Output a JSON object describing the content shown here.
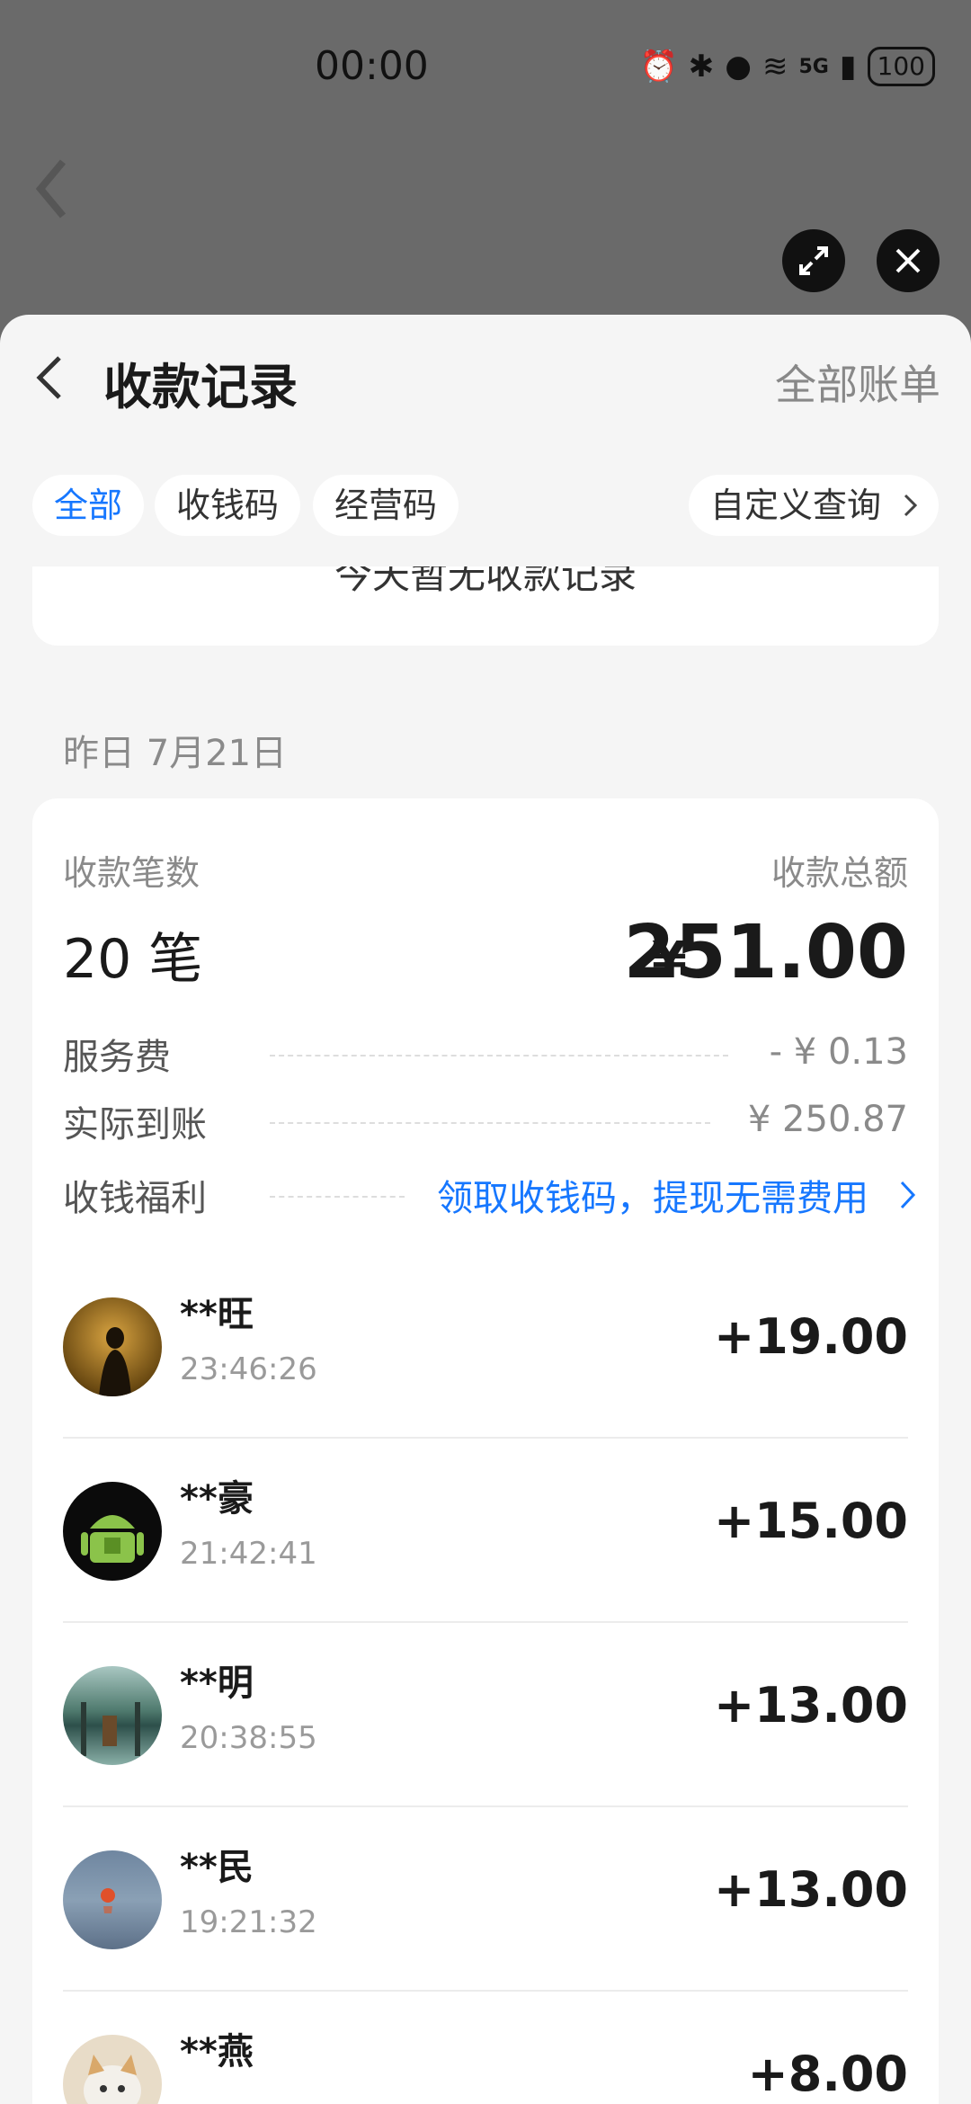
{
  "status": {
    "time": "00:00",
    "battery": "100",
    "network": "5G"
  },
  "header": {
    "title": "收款记录",
    "all_bill": "全部账单"
  },
  "filters": {
    "all": "全部",
    "qr_collect": "收钱码",
    "business_code": "经营码",
    "custom_query": "自定义查询"
  },
  "prev_card_text": "今天暂无收款记录",
  "date_label": "昨日 7月21日",
  "summary": {
    "count_label": "收款笔数",
    "count_value": "20 笔",
    "total_label": "收款总额",
    "currency": "¥",
    "total_value": "251.00",
    "service_fee_label": "服务费",
    "service_fee_value": "- ¥ 0.13",
    "net_label": "实际到账",
    "net_value": "¥ 250.87",
    "benefit_label": "收钱福利",
    "benefit_value": "领取收钱码，提现无需费用"
  },
  "transactions": [
    {
      "name": "**旺",
      "time": "23:46:26",
      "amount": "+19.00"
    },
    {
      "name": "**豪",
      "time": "21:42:41",
      "amount": "+15.00"
    },
    {
      "name": "**明",
      "time": "20:38:55",
      "amount": "+13.00"
    },
    {
      "name": "**民",
      "time": "19:21:32",
      "amount": "+13.00"
    },
    {
      "name": "**燕",
      "time": "",
      "amount": "+8.00"
    }
  ],
  "colors": {
    "accent": "#1677ff",
    "sheet_bg": "#f5f5f5",
    "overlay": "#6a6a6a"
  }
}
